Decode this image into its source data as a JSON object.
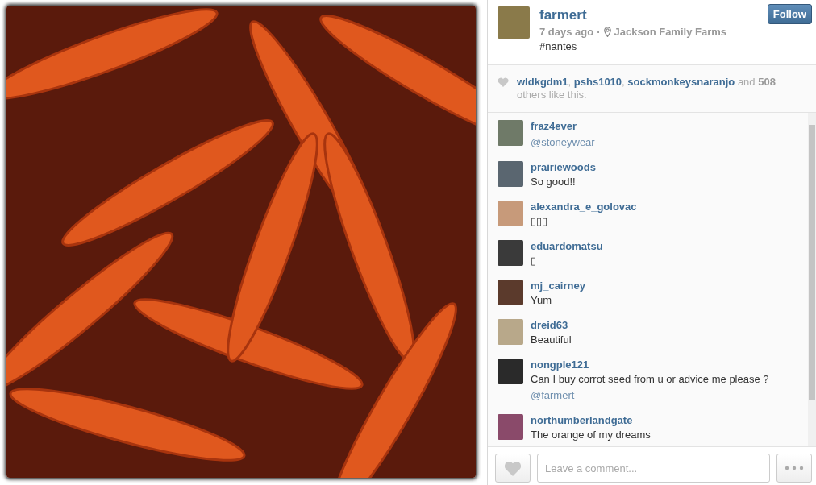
{
  "photo": {
    "kind": "photo"
  },
  "post": {
    "username": "farmert",
    "time": "7 days ago",
    "separator": "·",
    "location": "Jackson Family Farms",
    "caption": "#nantes",
    "follow_button": "Follow"
  },
  "likes": {
    "likers": [
      "wldkgdm1",
      "pshs1010",
      "sockmonkeysnaranjo"
    ],
    "list_separator": ",",
    "and_text": "and",
    "count": "508",
    "others_text": "others like this."
  },
  "comments": [
    {
      "user": "fraz4ever",
      "text": "@stoneywear",
      "kind": "mention",
      "color": "#6f7a68"
    },
    {
      "user": "prairiewoods",
      "text": "So good!!",
      "kind": "plain",
      "color": "#5a6670"
    },
    {
      "user": "alexandra_e_golovac",
      "text": "▯▯▯",
      "kind": "plain",
      "color": "#c79a7a"
    },
    {
      "user": "eduardomatsu",
      "text": "▯",
      "kind": "plain",
      "color": "#3a3a3a"
    },
    {
      "user": "mj_cairney",
      "text": "Yum",
      "kind": "plain",
      "color": "#5b3a2c"
    },
    {
      "user": "dreid63",
      "text": "Beautiful",
      "kind": "plain",
      "color": "#b8a88a"
    },
    {
      "user": "nongple121",
      "text": "Can I buy corrot seed from u or advice me please ?",
      "mention": "@farmert",
      "kind": "plain",
      "color": "#2a2a2a"
    },
    {
      "user": "northumberlandgate",
      "text": "The orange of my dreams",
      "kind": "plain",
      "color": "#8a4a6a"
    }
  ],
  "comment_box": {
    "placeholder": "Leave a comment..."
  }
}
